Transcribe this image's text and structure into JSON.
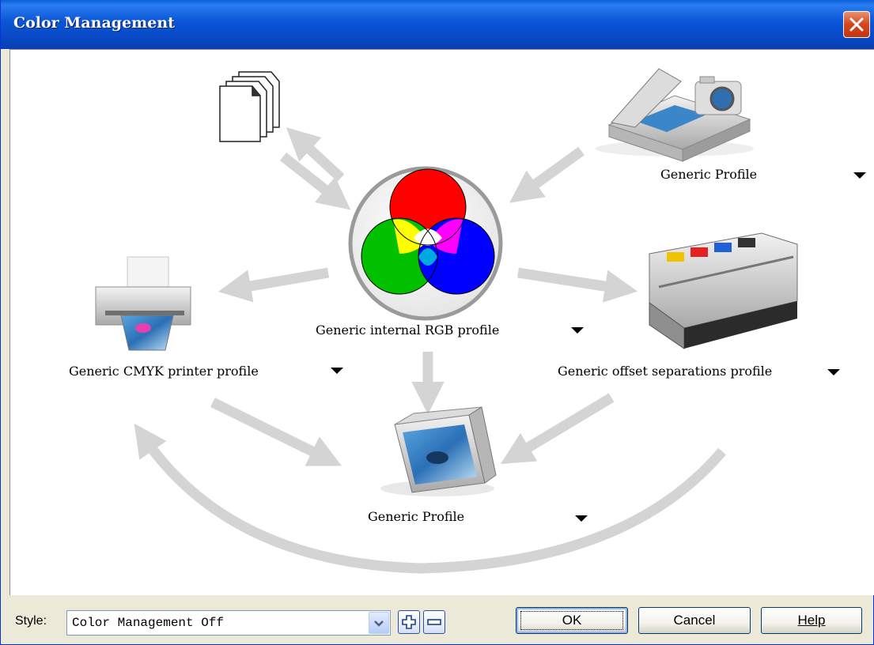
{
  "window": {
    "title": "Color Management"
  },
  "diagram": {
    "input_profile": "Generic Profile",
    "internal_profile": "Generic internal RGB profile",
    "printer_profile": "Generic CMYK printer profile",
    "separations_profile": "Generic offset separations profile",
    "monitor_profile": "Generic Profile"
  },
  "icons": {
    "documents": "documents-icon",
    "scanner_camera": "scanner-camera-icon",
    "color_wheel": "rgb-color-wheel-icon",
    "printer": "printer-icon",
    "press": "offset-press-icon",
    "monitor": "monitor-icon"
  },
  "colors": {
    "titlebar": "#0a55d6",
    "close": "#d6451f",
    "arrow": "#d4d4d4"
  },
  "footer": {
    "style_label": "Style:",
    "style_value": "Color Management Off",
    "ok": "OK",
    "cancel": "Cancel",
    "help": "Help"
  }
}
